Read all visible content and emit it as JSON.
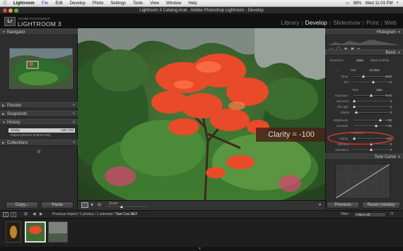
{
  "menubar": {
    "app_name": "Lightroom",
    "items": [
      "File",
      "Edit",
      "Develop",
      "Photo",
      "Settings",
      "Tools",
      "View",
      "Window",
      "Help"
    ],
    "status": [
      "98%"
    ],
    "clock": "Wed 11:03 PM"
  },
  "window": {
    "title": "Lightroom 3 Catalog.lrcat - Adobe Photoshop Lightroom - Develop"
  },
  "identity": {
    "logo": "Lr",
    "brand_small": "ADOBE PHOTOSHOP",
    "brand_big": "LIGHTROOM 3",
    "modules": [
      "Library",
      "Develop",
      "Slideshow",
      "Print",
      "Web"
    ],
    "active_module": "Develop"
  },
  "left_panel": {
    "navigator": "Navigator",
    "presets": "Presets",
    "snapshots": "Snapshots",
    "history": "History",
    "history_items": [
      {
        "name": "Clarity",
        "from": "-100",
        "to": "-100"
      },
      {
        "name": "Import (2/14/12 8:38:43 PM)",
        "from": "",
        "to": ""
      }
    ],
    "collections": "Collections",
    "copy_label": "Copy...",
    "paste_label": "Paste"
  },
  "right_panel": {
    "histogram": "Histogram",
    "basic": "Basic",
    "treatment": "Treatment :",
    "color": "Color",
    "bw": "Black & White",
    "wb": "WB :",
    "wb_value": "As Shot",
    "temp_label": "Temp",
    "temp_value": "4100",
    "tint_label": "Tint",
    "tint_value": "+ 8",
    "tone": "Tone",
    "auto": "Auto",
    "exposure_label": "Exposure",
    "exposure_value": "0.00",
    "recovery_label": "Recovery",
    "recovery_value": "0",
    "filllight_label": "Fill Light",
    "filllight_value": "0",
    "blacks_label": "Blacks",
    "blacks_value": "5",
    "brightness_label": "Brightness",
    "brightness_value": "+ 50",
    "contrast_label": "Contrast",
    "contrast_value": "+ 25",
    "presence": "Presence",
    "clarity_label": "Clarity",
    "clarity_value": "- 100",
    "vibrance_label": "Vibrance",
    "vibrance_value": "0",
    "saturation_label": "Saturation",
    "saturation_value": "0",
    "tone_curve": "Tone Curve",
    "previous_label": "Previous",
    "reset_label": "Reset (Adobe)"
  },
  "toolbar": {
    "zoom_label": "Zoom"
  },
  "filmstrip": {
    "page1": "1",
    "page2": "2",
    "source": "Previous Import / 3 photos / 1 selected /",
    "filename": "Tam Coc.NEF",
    "filter_label": "Filter :",
    "filter_value": "Filters Off"
  },
  "annotation": {
    "text": "Clarity = -100",
    "color": "#d9362b"
  }
}
